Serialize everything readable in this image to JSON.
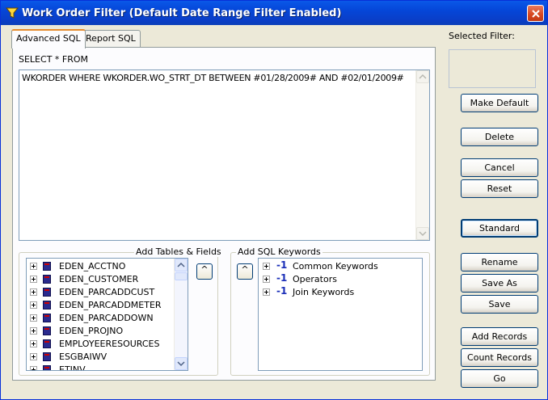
{
  "window": {
    "title": "Work Order Filter (Default Date Range Filter Enabled)"
  },
  "tabs": [
    {
      "label": "Advanced SQL",
      "active": true
    },
    {
      "label": "Report SQL",
      "active": false
    }
  ],
  "sql": {
    "prefix_label": "SELECT * FROM",
    "query_text": "WKORDER WHERE  WKORDER.WO_STRT_DT BETWEEN #01/28/2009# AND #02/01/2009#"
  },
  "tables_fields": {
    "group_label": "Add Tables & Fields",
    "items": [
      "EDEN_ACCTNO",
      "EDEN_CUSTOMER",
      "EDEN_PARCADDCUST",
      "EDEN_PARCADDMETER",
      "EDEN_PARCADDOWN",
      "EDEN_PROJNO",
      "EMPLOYEERESOURCES",
      "ESGBAIWV",
      "ETINV"
    ],
    "add_button": "^"
  },
  "sql_keywords": {
    "group_label": "Add SQL Keywords",
    "icon_glyph": "-1",
    "items": [
      "Common Keywords",
      "Operators",
      "Join Keywords"
    ],
    "add_button": "^"
  },
  "selected_filter": {
    "label": "Selected Filter:",
    "value": ""
  },
  "buttons": {
    "make_default": "Make Default",
    "delete": "Delete",
    "cancel": "Cancel",
    "reset": "Reset",
    "standard": "Standard",
    "rename": "Rename",
    "save_as": "Save As",
    "save": "Save",
    "add_records": "Add Records",
    "count_records": "Count Records",
    "go": "Go"
  },
  "colors": {
    "titlebar": "#0a3ec7",
    "window_bg": "#ece9d8",
    "close_button": "#d6461f",
    "active_tab_accent": "#e68b2c"
  }
}
